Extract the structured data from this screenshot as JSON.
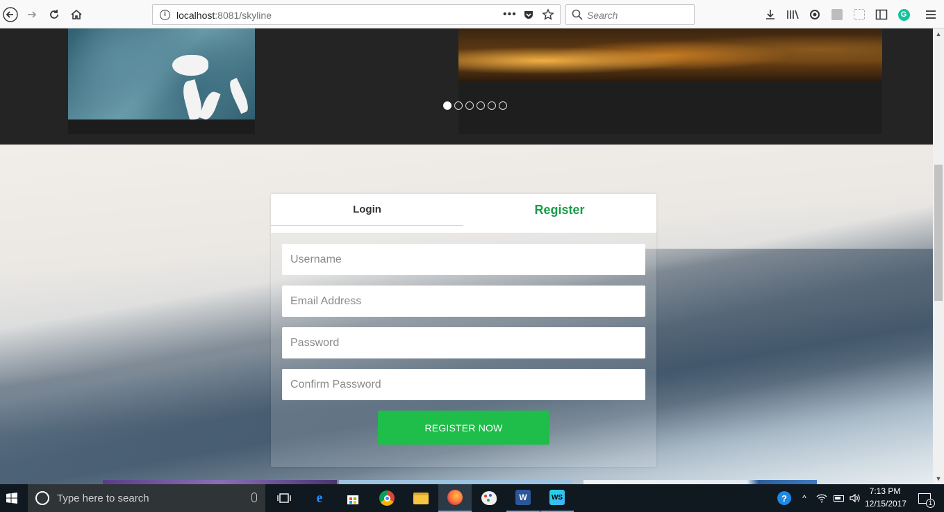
{
  "browser": {
    "url_host": "localhost",
    "url_port_path": ":8081/skyline",
    "search_placeholder": "Search",
    "icons": [
      "back-icon",
      "forward-icon",
      "reload-icon",
      "home-icon",
      "info-icon",
      "more-icon",
      "pocket-icon",
      "star-icon",
      "download-icon",
      "library-icon",
      "sync-icon",
      "sidebar-icon",
      "grammarly-icon",
      "menu-icon"
    ]
  },
  "slider": {
    "dots_count": 6,
    "active_dot": 0
  },
  "auth": {
    "tab_login": "Login",
    "tab_register": "Register",
    "active_tab": "Register",
    "username_placeholder": "Username",
    "email_placeholder": "Email Address",
    "password_placeholder": "Password",
    "confirm_placeholder": "Confirm Password",
    "submit_label": "REGISTER NOW",
    "accent_color": "#1a9c49",
    "button_color": "#1fbd4a"
  },
  "taskbar": {
    "search_text": "Type here to search",
    "time": "7:13 PM",
    "date": "12/15/2017",
    "notification_count": "1",
    "apps": [
      "task-view",
      "edge",
      "store",
      "chrome",
      "file-explorer",
      "firefox",
      "paint",
      "word",
      "webstorm"
    ]
  }
}
